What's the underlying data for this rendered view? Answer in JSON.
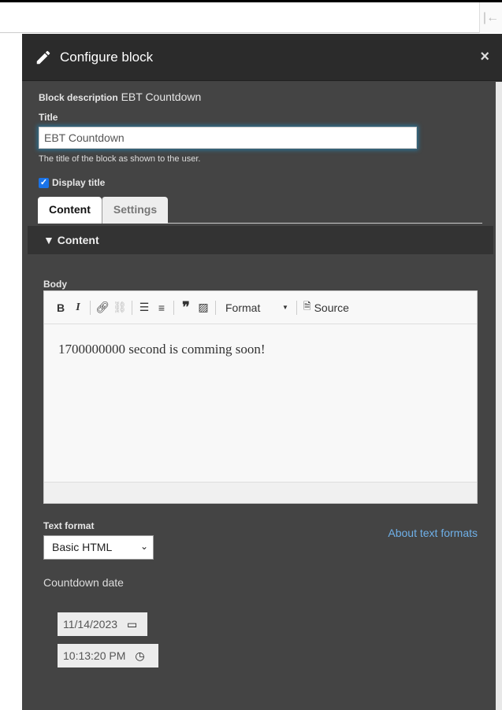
{
  "dialog": {
    "title": "Configure block",
    "close_label": "×"
  },
  "block_description": {
    "label": "Block description",
    "value": "EBT Countdown"
  },
  "title_field": {
    "label": "Title",
    "value": "EBT Countdown",
    "description": "The title of the block as shown to the user."
  },
  "display_title": {
    "label": "Display title",
    "checked": true
  },
  "tabs": [
    {
      "label": "Content",
      "active": true
    },
    {
      "label": "Settings",
      "active": false
    }
  ],
  "section": {
    "label": "▼ Content"
  },
  "body": {
    "label": "Body",
    "toolbar": {
      "bold": "B",
      "italic": "I",
      "format": "Format",
      "source": "Source"
    },
    "content": "1700000000 second is comming soon!"
  },
  "text_format": {
    "label": "Text format",
    "selected": "Basic HTML",
    "help_link": "About text formats"
  },
  "countdown": {
    "label": "Countdown date",
    "date": "11/14/2023",
    "time": "10:13:20 PM"
  }
}
